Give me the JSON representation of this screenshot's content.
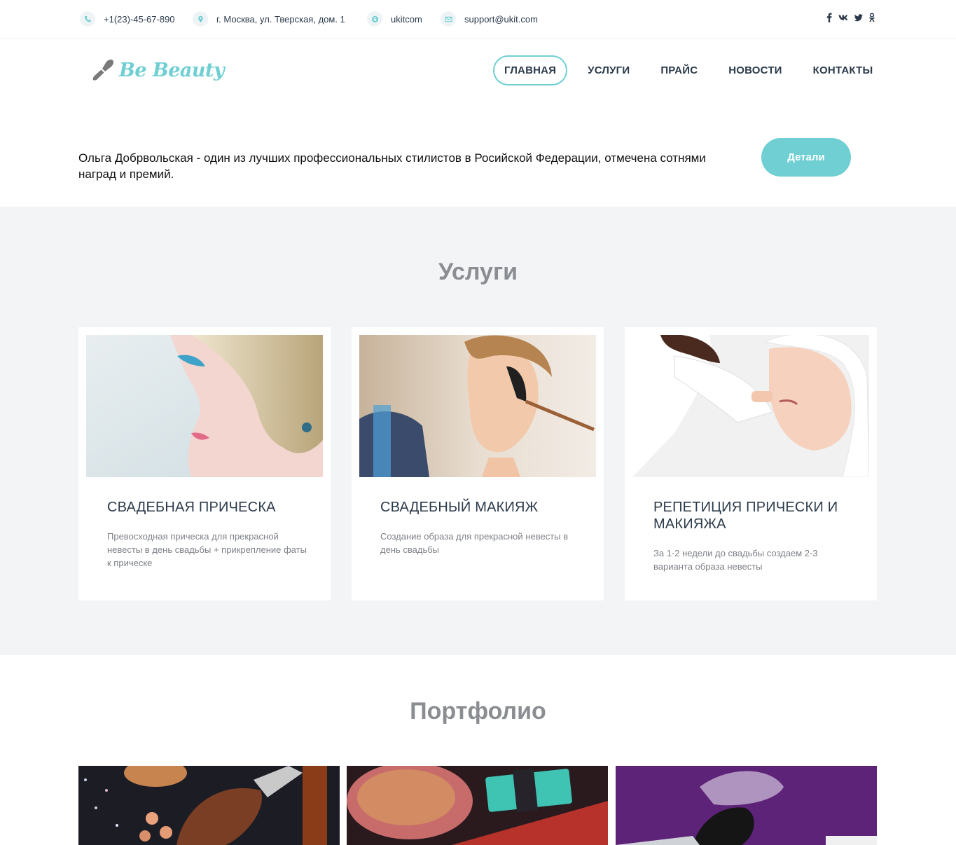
{
  "topbar": {
    "phone": "+1(23)-45-67-890",
    "address": "г. Москва, ул. Тверская, дом. 1",
    "skype": "ukitcom",
    "email": "support@ukit.com",
    "social_icons": [
      "facebook-icon",
      "vk-icon",
      "twitter-icon",
      "odnoklassniki-icon"
    ]
  },
  "header": {
    "logo_text": "Be Beauty",
    "nav": [
      {
        "label": "ГЛАВНАЯ",
        "active": true
      },
      {
        "label": "УСЛУГИ",
        "active": false
      },
      {
        "label": "ПРАЙС",
        "active": false
      },
      {
        "label": "НОВОСТИ",
        "active": false
      },
      {
        "label": "КОНТАКТЫ",
        "active": false
      }
    ]
  },
  "intro": {
    "text": "Ольга Добрвольская - один из лучших профессиональных стилистов в Росийской Федерации, отмечена сотнями наград и премий.",
    "button": "Детали"
  },
  "services": {
    "title": "Услуги",
    "cards": [
      {
        "title": "СВАДЕБНАЯ ПРИЧЕСКА",
        "text": "Превосходная прическа для прекрасной невесты в день свадьбы + прикрепление фаты к прическе"
      },
      {
        "title": "СВАДЕБНЫЙ МАКИЯЖ",
        "text": "Создание образа для прекрасной невесты в день свадьбы"
      },
      {
        "title": "РЕПЕТИЦИЯ ПРИЧЕСКИ И МАКИЯЖА",
        "text": "За 1-2 недели до свадьбы создаем 2-3 варианта образа невесты"
      }
    ]
  },
  "portfolio": {
    "title": "Портфолио"
  },
  "colors": {
    "accent": "#6fcfd3",
    "text_dark": "#2b3a4a",
    "section_bg": "#f3f4f6",
    "heading_gray": "#8a8d91"
  }
}
